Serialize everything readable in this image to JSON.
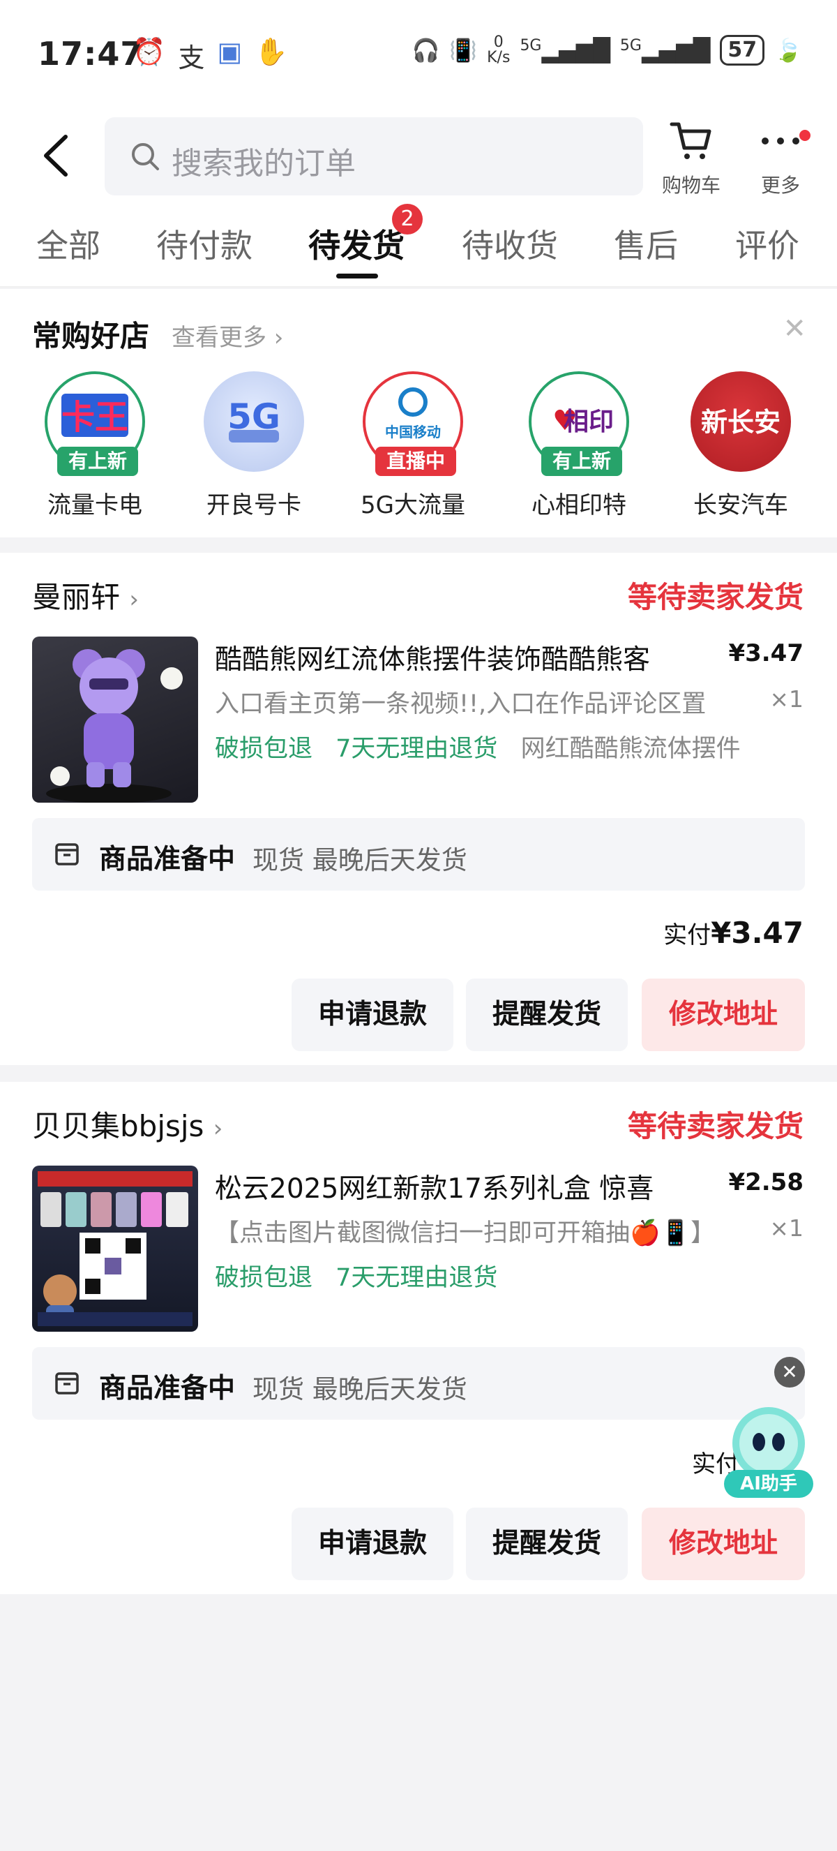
{
  "status_bar": {
    "time": "17:47",
    "net_speed_top": "0",
    "net_speed_unit": "K/s",
    "signal1": "5G",
    "signal2": "5G",
    "battery": "57"
  },
  "header": {
    "search_placeholder": "搜索我的订单",
    "cart_label": "购物车",
    "more_label": "更多"
  },
  "tabs": [
    {
      "label": "全部",
      "active": false
    },
    {
      "label": "待付款",
      "active": false
    },
    {
      "label": "待发货",
      "active": true,
      "badge": "2"
    },
    {
      "label": "待收货",
      "active": false
    },
    {
      "label": "售后",
      "active": false
    },
    {
      "label": "评价",
      "active": false
    }
  ],
  "frequent_shops": {
    "title": "常购好店",
    "more": "查看更多",
    "items": [
      {
        "name": "流量卡电",
        "tag": "有上新",
        "tag_color": "#27a36a"
      },
      {
        "name": "开良号卡",
        "tag": ""
      },
      {
        "name": "5G大流量",
        "tag": "直播中",
        "tag_color": "#e5343d",
        "logo_text": "中国移动"
      },
      {
        "name": "心相印特",
        "tag": "有上新",
        "tag_color": "#27a36a",
        "logo_text": "相印"
      },
      {
        "name": "长安汽车",
        "tag": "",
        "logo_text": "新长安"
      }
    ]
  },
  "orders": [
    {
      "store": "曼丽轩",
      "status": "等待卖家发货",
      "product_title": "酷酷熊网红流体熊摆件装饰酷酷熊客",
      "price": "¥3.47",
      "spec": "入口看主页第一条视频!!,入口在作品评论区置",
      "qty": "×1",
      "tags": [
        "破损包退",
        "7天无理由退货"
      ],
      "tag_extra": "网红酷酷熊流体摆件",
      "prep_title": "商品准备中",
      "prep_detail": "现货 最晚后天发货",
      "paid_label": "实付",
      "paid_amount": "¥3.47",
      "buttons": {
        "refund": "申请退款",
        "remind": "提醒发货",
        "address": "修改地址"
      }
    },
    {
      "store": "贝贝集bbjsjs",
      "status": "等待卖家发货",
      "product_title": "松云2025网红新款17系列礼盒 惊喜",
      "price": "¥2.58",
      "spec": "【点击图片截图微信扫一扫即可开箱抽🍎📱】",
      "qty": "×1",
      "tags": [
        "破损包退",
        "7天无理由退货"
      ],
      "tag_extra": "",
      "prep_title": "商品准备中",
      "prep_detail": "现货 最晚后天发货",
      "paid_label": "实付",
      "paid_amount": "",
      "buttons": {
        "refund": "申请退款",
        "remind": "提醒发货",
        "address": "修改地址"
      }
    }
  ],
  "ai_assistant": {
    "label": "AI助手"
  }
}
